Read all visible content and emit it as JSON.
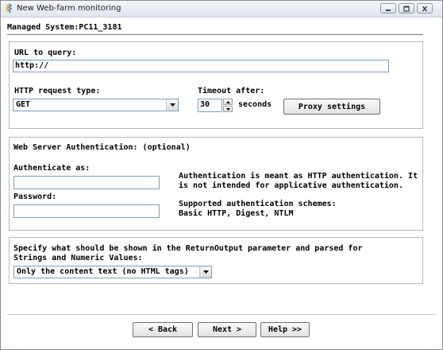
{
  "window": {
    "title": "New Web-farm monitoring",
    "buttons": {
      "minimize": "",
      "maximize": "",
      "close": ""
    }
  },
  "header": {
    "managed_system": "Managed System:PC11_3181"
  },
  "url_group": {
    "url_label": "URL to query:",
    "url_value": "http://",
    "request_type_label": "HTTP request type:",
    "request_type_value": "GET",
    "timeout_label": "Timeout after:",
    "timeout_value": "30",
    "timeout_unit": "seconds",
    "proxy_button": "Proxy settings"
  },
  "auth_group": {
    "title": "Web Server Authentication: (optional)",
    "authenticate_label": "Authenticate as:",
    "authenticate_value": "",
    "password_label": "Password:",
    "password_value": "",
    "info_line1": "Authentication is meant as HTTP authentication. It",
    "info_line2": "is not intended for applicative authentication.",
    "schemes_line1": "Supported authentication schemes:",
    "schemes_line2": "Basic HTTP, Digest, NTLM"
  },
  "output_group": {
    "text_line1": "Specify what should be shown in the ReturnOutput parameter and parsed for",
    "text_line2": "Strings and Numeric Values:",
    "select_value": "Only the content text (no HTML tags)"
  },
  "footer": {
    "back_button": "< Back",
    "next_button": "Next >",
    "help_button": "Help >>"
  }
}
